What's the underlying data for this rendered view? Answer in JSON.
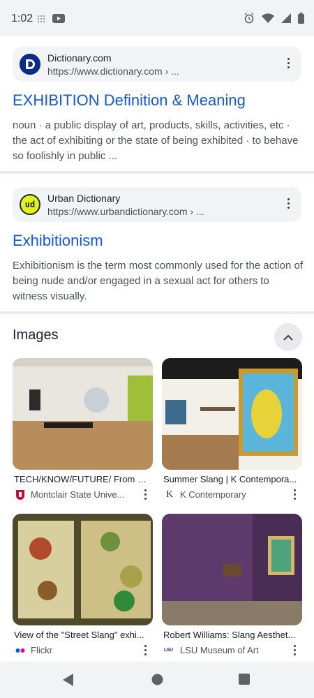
{
  "status_bar": {
    "time": "1:02",
    "left_icons": [
      "grid-icon",
      "youtube-icon"
    ],
    "right_icons": [
      "alarm-icon",
      "wifi-icon",
      "signal-icon",
      "battery-icon"
    ]
  },
  "results": [
    {
      "site_name": "Dictionary.com",
      "url": "https://www.dictionary.com › ...",
      "title": "EXHIBITION Definition & Meaning",
      "snippet": "noun · a public display of art, products, skills, activities, etc · the act of exhibiting or the state of being exhibited · to behave so foolishly in public ..."
    },
    {
      "site_name": "Urban Dictionary",
      "logo_text": "ud",
      "url": "https://www.urbandictionary.com › ...",
      "title": "Exhibitionism",
      "snippet": "Exhibitionism is the term most commonly used for the action of being nude and/or engaged in a sexual act for others to witness visually."
    }
  ],
  "images_section": {
    "heading": "Images",
    "items": [
      {
        "title": "TECH/KNOW/FUTURE/ From Sl...",
        "source": "Montclair State Unive..."
      },
      {
        "title": "Summer Slang | K Contempora...",
        "source": "K Contemporary",
        "source_icon_text": "K"
      },
      {
        "title": "View of the \"Street Slang\" exhi...",
        "source": "Flickr"
      },
      {
        "title": "Robert Williams: Slang Aesthet...",
        "source": "LSU Museum of Art",
        "source_icon_text": "LSU"
      }
    ]
  },
  "nav_bar": {
    "icons": [
      "back-icon",
      "home-icon",
      "recents-icon"
    ]
  },
  "colors": {
    "link": "#1558d6",
    "snippet": "#4d5156",
    "card_bg": "#f1f3f4"
  }
}
